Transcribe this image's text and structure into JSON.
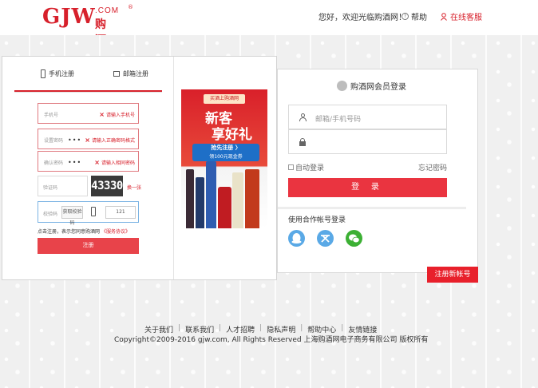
{
  "brand": {
    "logo_main": "GJW",
    "logo_com": ".COM",
    "logo_reg": "®",
    "logo_cn": "购酒网",
    "accent_color": "#d7202b"
  },
  "header": {
    "greeting": "您好，欢迎光临购酒网！",
    "help_label": "帮助",
    "online_service_label": "在线客服"
  },
  "register": {
    "tab_phone": "手机注册",
    "tab_email": "邮箱注册",
    "fields": {
      "phone": {
        "placeholder": "手机号",
        "error": "请输入手机号"
      },
      "password": {
        "placeholder": "设置密码",
        "value": "•••",
        "error": "请输入正确密码格式"
      },
      "confirm": {
        "placeholder": "确认密码",
        "value": "•••",
        "error": "请输入相同密码"
      }
    },
    "captcha": {
      "placeholder": "验证码",
      "code": "43330",
      "refresh_label": "换一张"
    },
    "sms": {
      "placeholder": "校验码",
      "button_label": "获取校验码",
      "count_label": "121"
    },
    "agree_text": "点击注册，表示您同意购酒网",
    "agree_link": "《服务协议》",
    "submit_label": "注册"
  },
  "ad": {
    "top_label": "买酒上购酒网",
    "title_line1": "新客",
    "title_line2": "享好礼",
    "badge_line1": "抢先注册 〉",
    "badge_line2": "领100元现金券"
  },
  "login": {
    "title": "购酒网会员登录",
    "account_placeholder": "邮箱/手机号码",
    "password_placeholder": "",
    "auto_login_label": "自动登录",
    "forgot_label": "忘记密码",
    "submit_label": "登 录",
    "partner_title": "使用合作帐号登录",
    "partners": [
      {
        "name": "QQ",
        "icon": "qq-icon",
        "glyph": ""
      },
      {
        "name": "Weibo",
        "icon": "weibo-icon",
        "glyph": ""
      },
      {
        "name": "WeChat",
        "icon": "wechat-icon",
        "glyph": ""
      }
    ],
    "register_tab_label": "注册新帐号"
  },
  "footer": {
    "links": [
      "关于我们",
      "联系我们",
      "人才招聘",
      "隐私声明",
      "帮助中心",
      "友情链接"
    ],
    "copyright": "Copyright©2009-2016 gjw.com, All Rights Reserved 上海购酒网电子商务有限公司 版权所有"
  }
}
